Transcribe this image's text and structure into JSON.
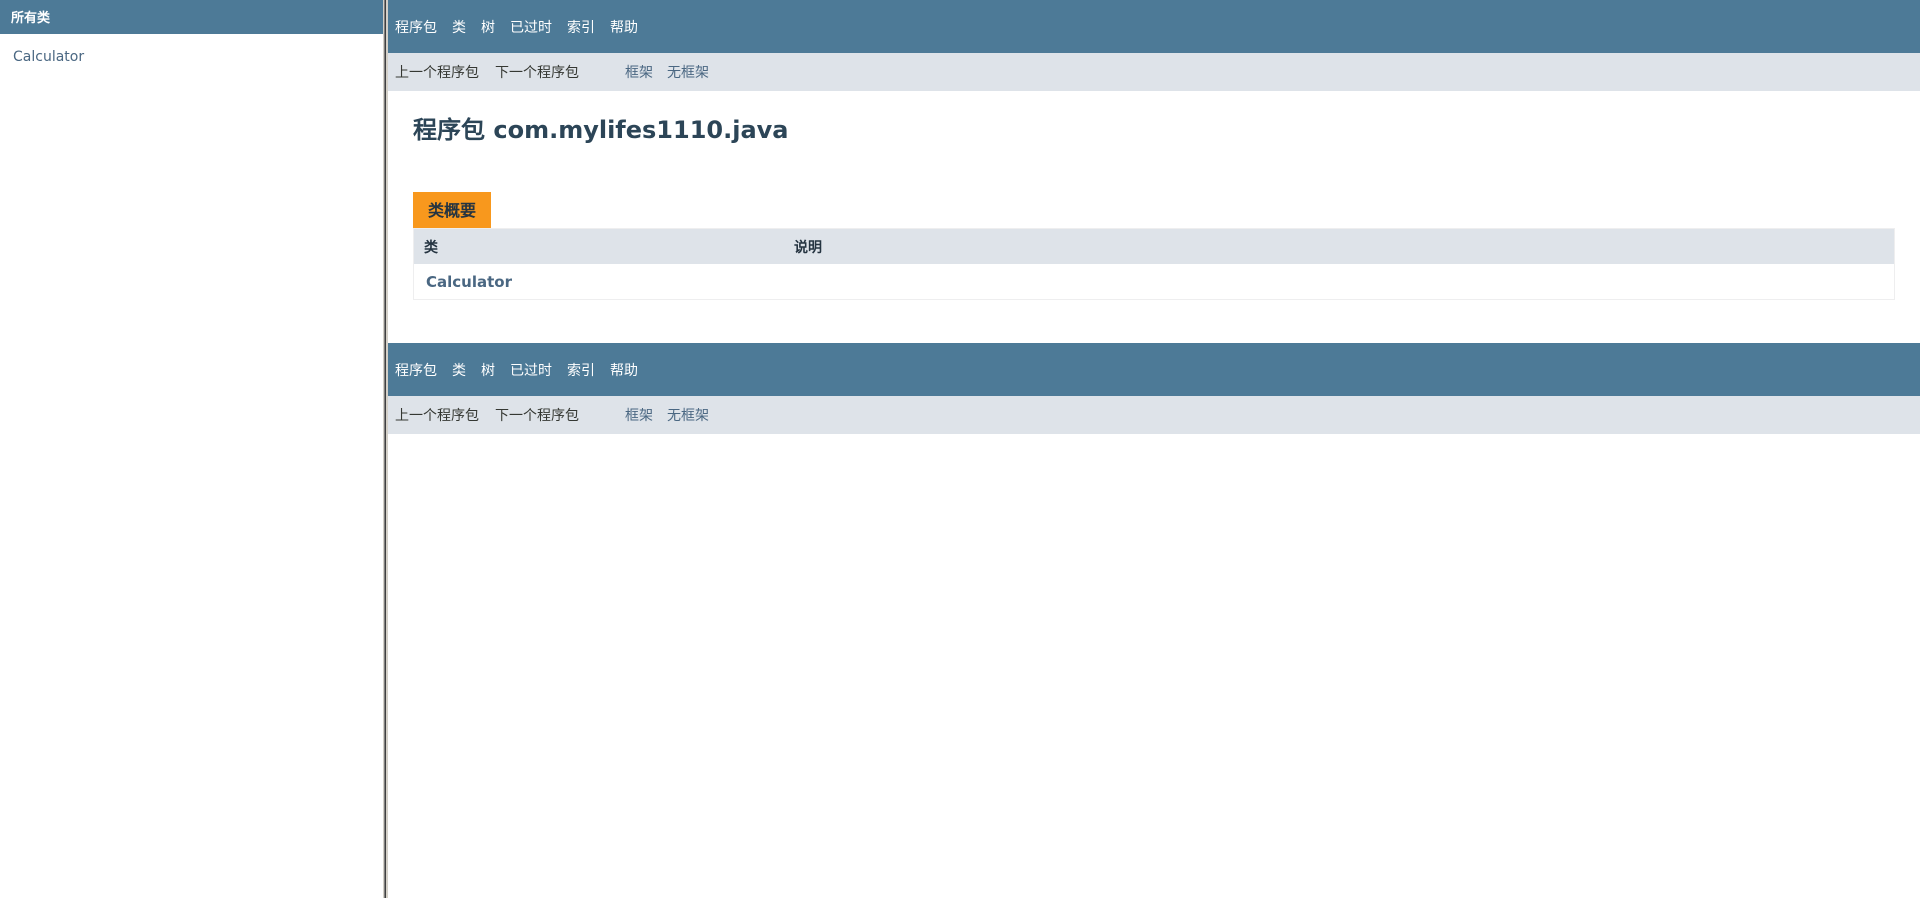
{
  "left_frame": {
    "header": "所有类",
    "classes": [
      "Calculator"
    ]
  },
  "navbar": {
    "top_items": [
      "程序包",
      "类",
      "树",
      "已过时",
      "索引",
      "帮助"
    ],
    "prev_package": "上一个程序包",
    "next_package": "下一个程序包",
    "frames": "框架",
    "no_frames": "无框架"
  },
  "content": {
    "title": "程序包 com.mylifes1110.java",
    "summary_tab": "类概要",
    "table": {
      "headers": [
        "类",
        "说明"
      ],
      "rows": [
        {
          "class": "Calculator",
          "description": ""
        }
      ]
    }
  },
  "colors": {
    "nav_bar": "#4d7a97",
    "sub_nav": "#dee3e9",
    "tab_accent": "#f8981d",
    "link": "#4a6782"
  }
}
